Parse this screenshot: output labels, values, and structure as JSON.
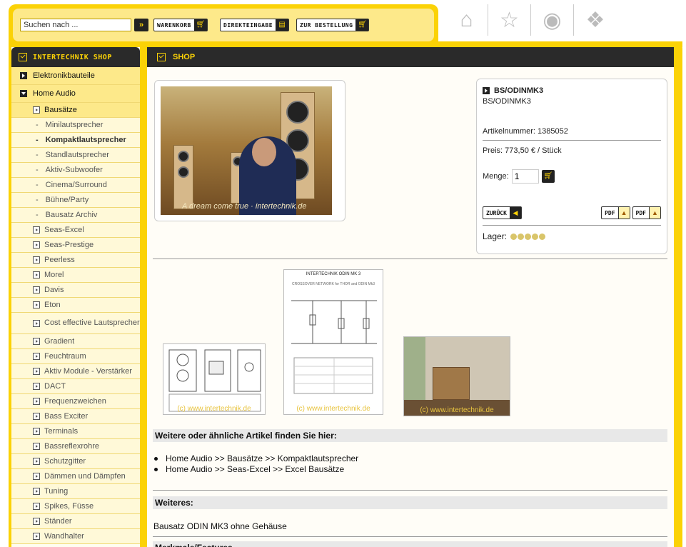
{
  "header": {
    "search_placeholder": "Suchen nach ...",
    "search_go": "»",
    "buttons": [
      {
        "label": "WARENKORB",
        "icon": "cart-icon"
      },
      {
        "label": "DIREKTEINGABE",
        "icon": "document-icon"
      },
      {
        "label": "ZUR BESTELLUNG",
        "icon": "cart-arrow-icon"
      }
    ],
    "nav_icons": [
      "home-icon",
      "star-icon",
      "fire-icon",
      "puzzle-icon"
    ]
  },
  "sidebar": {
    "title": "INTERTECHNIK SHOP",
    "items": [
      {
        "label": "Elektronikbauteile",
        "level": 0,
        "open": false
      },
      {
        "label": "Home Audio",
        "level": 0,
        "open": true
      },
      {
        "label": "Bausätze",
        "level": 1
      },
      {
        "label": "Minilautsprecher",
        "level": 2
      },
      {
        "label": "Kompaktlautsprecher",
        "level": 2,
        "active": true
      },
      {
        "label": "Standlautsprecher",
        "level": 2
      },
      {
        "label": "Aktiv-Subwoofer",
        "level": 2
      },
      {
        "label": "Cinema/Surround",
        "level": 2
      },
      {
        "label": "Bühne/Party",
        "level": 2
      },
      {
        "label": "Bausatz Archiv",
        "level": 2
      },
      {
        "label": "Seas-Excel",
        "level": 1
      },
      {
        "label": "Seas-Prestige",
        "level": 1
      },
      {
        "label": "Peerless",
        "level": 1
      },
      {
        "label": "Morel",
        "level": 1
      },
      {
        "label": "Davis",
        "level": 1
      },
      {
        "label": "Eton",
        "level": 1
      },
      {
        "label": "Cost effective Lautsprecher",
        "level": 1,
        "tall": true
      },
      {
        "label": "Gradient",
        "level": 1
      },
      {
        "label": "Feuchtraum",
        "level": 1
      },
      {
        "label": "Aktiv Module - Verstärker",
        "level": 1
      },
      {
        "label": "DACT",
        "level": 1
      },
      {
        "label": "Frequenzweichen",
        "level": 1
      },
      {
        "label": "Bass Exciter",
        "level": 1
      },
      {
        "label": "Terminals",
        "level": 1
      },
      {
        "label": "Bassreflexrohre",
        "level": 1
      },
      {
        "label": "Schutzgitter",
        "level": 1
      },
      {
        "label": "Dämmen und Dämpfen",
        "level": 1
      },
      {
        "label": "Tuning",
        "level": 1
      },
      {
        "label": "Spikes, Füsse",
        "level": 1
      },
      {
        "label": "Ständer",
        "level": 1
      },
      {
        "label": "Wandhalter",
        "level": 1
      }
    ]
  },
  "main": {
    "title": "SHOP",
    "photo_watermark": "A dream come true · intertechnik.de",
    "product": {
      "name": "BS/ODINMK3",
      "subname": "BS/ODINMK3",
      "art_label": "Artikelnummer: 1385052",
      "price_label": "Preis: 773,50 € / Stück",
      "menge_label": "Menge:",
      "menge_value": "1",
      "back_label": "ZURÜCK",
      "pdf_label": "PDF",
      "lager_label": "Lager:",
      "lager_level": 5
    },
    "thumbs": [
      {
        "name": "drawing-thumb",
        "watermark": "(c) www.intertechnik.de"
      },
      {
        "name": "crossover-thumb",
        "watermark": "(c) www.intertechnik.de",
        "heading": "INTERTECHNIK ODIN MK 3",
        "sub": "CROSSOVER NETWORK for THOR and ODIN Mk3"
      },
      {
        "name": "room-thumb",
        "watermark": "(c) www.intertechnik.de"
      }
    ],
    "similar_title": "Weitere oder ähnliche Artikel finden Sie hier:",
    "similar_links": [
      "Home Audio >> Bausätze >> Kompaktlautsprecher",
      "Home Audio >> Seas-Excel >> Excel Bausätze"
    ],
    "weiteres_title": "Weiteres:",
    "weiteres_text": "Bausatz ODIN MK3 ohne Gehäuse",
    "next_title": "Merkmale/Features"
  }
}
